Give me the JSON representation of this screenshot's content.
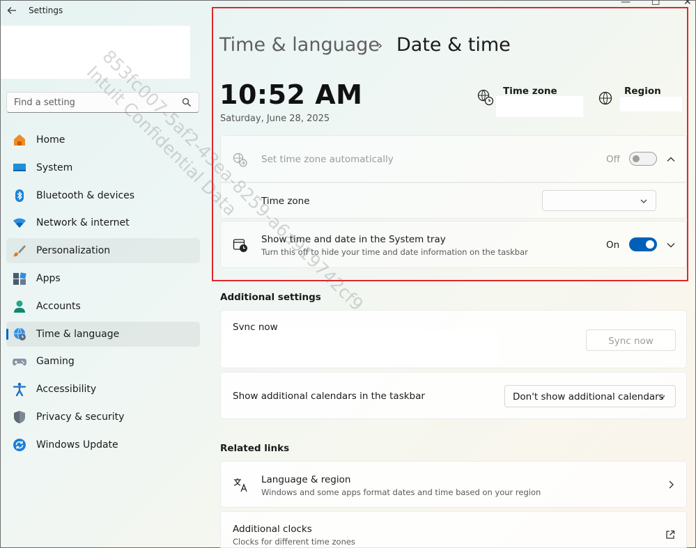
{
  "window": {
    "title": "Settings",
    "back_glyph": "←",
    "minimize_glyph": "—",
    "maximize_glyph": "☐",
    "close_glyph": "✕"
  },
  "sidebar": {
    "search_placeholder": "Find a setting",
    "items": [
      {
        "label": "Home",
        "icon": "home-icon"
      },
      {
        "label": "System",
        "icon": "system-icon"
      },
      {
        "label": "Bluetooth & devices",
        "icon": "bluetooth-icon"
      },
      {
        "label": "Network & internet",
        "icon": "wifi-icon"
      },
      {
        "label": "Personalization",
        "icon": "brush-icon"
      },
      {
        "label": "Apps",
        "icon": "apps-icon"
      },
      {
        "label": "Accounts",
        "icon": "person-icon"
      },
      {
        "label": "Time & language",
        "icon": "globe-clock-icon"
      },
      {
        "label": "Gaming",
        "icon": "gamepad-icon"
      },
      {
        "label": "Accessibility",
        "icon": "accessibility-icon"
      },
      {
        "label": "Privacy & security",
        "icon": "shield-icon"
      },
      {
        "label": "Windows Update",
        "icon": "update-icon"
      }
    ],
    "active_index": 7,
    "hover_index": 4
  },
  "header": {
    "parent": "Time & language",
    "separator": "›",
    "title": "Date & time"
  },
  "clock": {
    "time": "10:52 AM",
    "date": "Saturday, June 28, 2025"
  },
  "summary": {
    "time_zone_label": "Time zone",
    "region_label": "Region"
  },
  "set_tz_auto": {
    "label": "Set time zone automatically",
    "state_label": "Off",
    "state": false
  },
  "time_zone_row": {
    "label": "Time zone"
  },
  "systray": {
    "title": "Show time and date in the System tray",
    "desc": "Turn this off to hide your time and date information on the taskbar",
    "state_label": "On",
    "state": true
  },
  "additional": {
    "heading": "Additional settings",
    "sync_title": "Sync now",
    "sync_button": "Sync now",
    "calendars_label": "Show additional calendars in the taskbar",
    "calendars_value": "Don't show additional calendars"
  },
  "related": {
    "heading": "Related links",
    "language_title": "Language & region",
    "language_desc": "Windows and some apps format dates and time based on your region",
    "clocks_title": "Additional clocks",
    "clocks_desc": "Clocks for different time zones"
  },
  "watermark": {
    "line1": "853fc007-5af2-43ea-8259-a6a919742cf9",
    "line2": "Intuit Confidential Data"
  },
  "colors": {
    "accent": "#005fb8",
    "highlight_border": "#e0262b"
  }
}
